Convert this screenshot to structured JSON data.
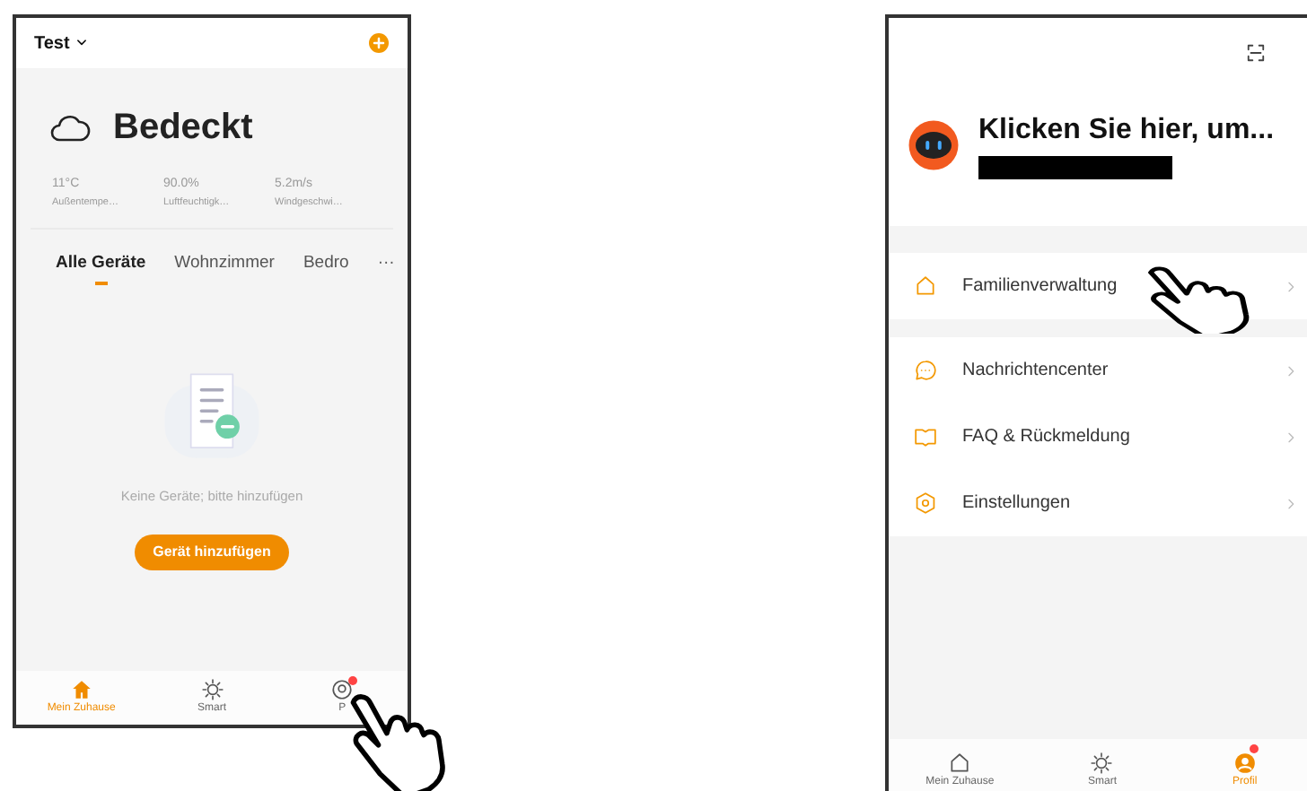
{
  "screens": [
    {
      "kind": "home",
      "home_name": "Test",
      "weather": {
        "condition": "Bedeckt",
        "stats": [
          {
            "value": "11°C",
            "label": "Außentempe…"
          },
          {
            "value": "90.0%",
            "label": "Luftfeuchtigk…"
          },
          {
            "value": "5.2m/s",
            "label": "Windgeschwi…"
          }
        ]
      },
      "tabs": [
        {
          "label": "Alle Geräte",
          "selected": true
        },
        {
          "label": "Wohnzimmer",
          "selected": false
        },
        {
          "label": "Bedro",
          "selected": false
        }
      ],
      "more": "···",
      "empty_text": "Keine Geräte; bitte hinzufügen",
      "add_button": "Gerät hinzufügen",
      "nav": [
        {
          "kind": "home",
          "label": "Mein Zuhause",
          "selected": true,
          "badge": false
        },
        {
          "kind": "smart",
          "label": "Smart",
          "selected": false,
          "badge": false
        },
        {
          "kind": "profile",
          "label": "P",
          "selected": false,
          "badge": true
        }
      ]
    },
    {
      "kind": "profile",
      "prompt": "Klicken Sie hier, um...",
      "menu": [
        {
          "kind": "home",
          "label": "Familienverwaltung"
        },
        {
          "kind": "message",
          "label": "Nachrichtencenter"
        },
        {
          "kind": "book",
          "label": "FAQ & Rückmeldung"
        },
        {
          "kind": "settings",
          "label": "Einstellungen"
        }
      ],
      "nav": [
        {
          "kind": "home",
          "label": "Mein Zuhause",
          "selected": false,
          "badge": false
        },
        {
          "kind": "smart",
          "label": "Smart",
          "selected": false,
          "badge": false
        },
        {
          "kind": "profile",
          "label": "Profil",
          "selected": true,
          "badge": true
        }
      ]
    }
  ]
}
